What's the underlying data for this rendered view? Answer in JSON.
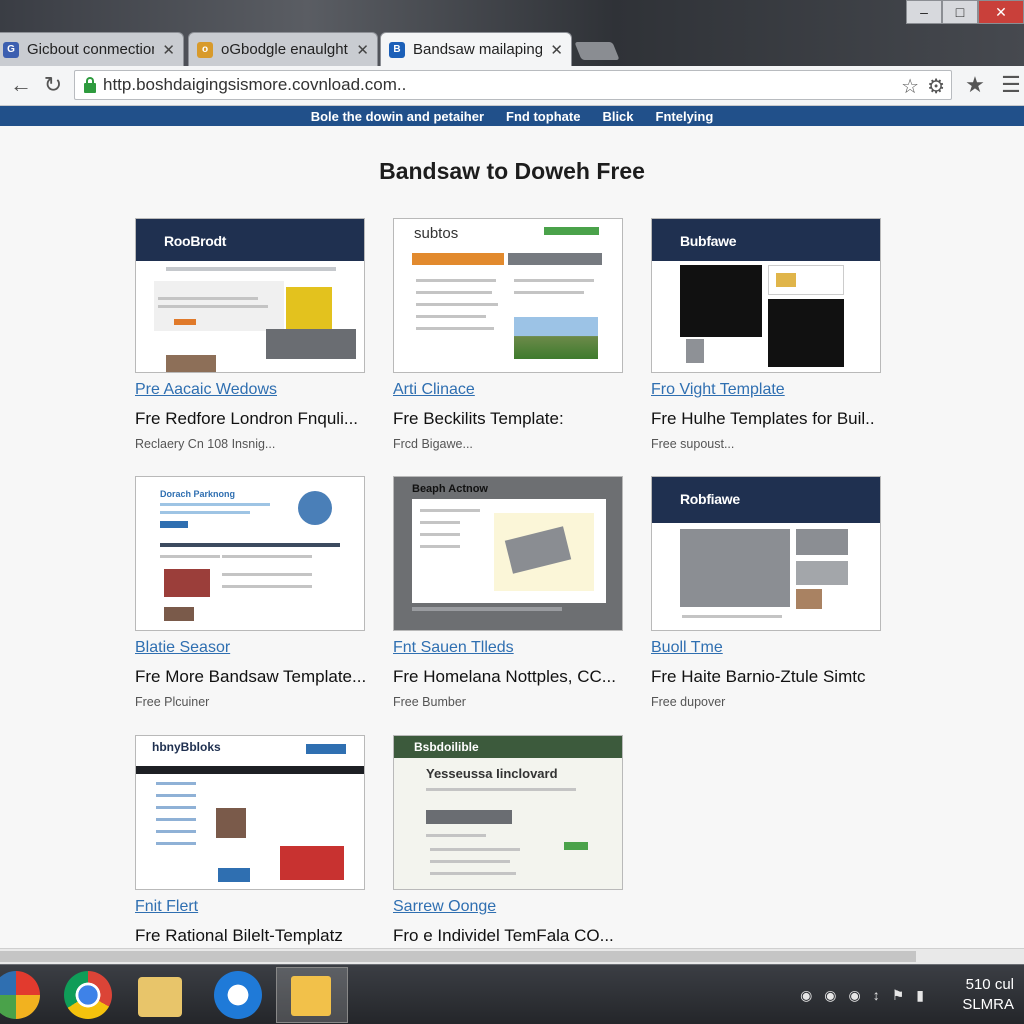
{
  "window": {
    "controls": [
      "–",
      "□",
      "✕"
    ]
  },
  "tabs": [
    {
      "label": "Gicbout conmections",
      "active": false,
      "favicon_color": "#3c5fb0",
      "favicon_glyph": "G"
    },
    {
      "label": "oGbodgle enaulghts",
      "active": false,
      "favicon_color": "#d89a2a",
      "favicon_glyph": "o"
    },
    {
      "label": "Bandsaw mailaping",
      "active": true,
      "favicon_color": "#1b5fb8",
      "favicon_glyph": "B"
    }
  ],
  "toolbar": {
    "url": "http.boshdaigingsismore.covnload.com..",
    "icons": [
      "back-arrow-icon",
      "forward-arrow-icon",
      "reload-icon",
      "star-icon",
      "settings-icon",
      "bookmark-icon",
      "menu-icon"
    ]
  },
  "site_nav": {
    "items": [
      "Bole the dowin and petaiher",
      "Fnd tophate",
      "Blick",
      "Fntelying"
    ]
  },
  "page": {
    "title": "Bandsaw to Doweh Free",
    "cards": [
      {
        "link": "Pre Aacaic Wedows",
        "name": "Fre Redfore Londron Fnquli...",
        "meta": "Reclaery Cn 108 Insnig...",
        "thumb_logo": "RooBrodt"
      },
      {
        "link": "Arti Clinace",
        "name": "Fre Beckilits Template:",
        "meta": "Frcd Bigawe...",
        "thumb_logo": "subtos"
      },
      {
        "link": "Fro Vight Template",
        "name": "Fre Hulhe Templates for Buil..",
        "meta": "Free supoust...",
        "thumb_logo": "Bubfawe"
      },
      {
        "link": "Blatie Seasor",
        "name": "Fre More Bandsaw Template...",
        "meta": "Free Plcuiner",
        "thumb_logo": "Dorach Parknong"
      },
      {
        "link": "Fnt Sauen Tlleds",
        "name": "Fre Homelana Nottples, CC...",
        "meta": "Free Bumber",
        "thumb_logo": "Beaph Actnow"
      },
      {
        "link": "Buoll Tme",
        "name": "Fre Haite Barnio-Ztule Simtc",
        "meta": "Free dupover",
        "thumb_logo": "Robfiawe"
      },
      {
        "link": "Fnit Flert",
        "name": "Fre Rational Bilelt-Templatz",
        "meta": "",
        "thumb_logo": "hbnyBbloks"
      },
      {
        "link": "Sarrew Oonge",
        "name": "Fro e Individel TemFala CO...",
        "meta": "",
        "thumb_logo": "Bsbdoilible",
        "thumb_heading": "Yesseussa Iinclovard"
      }
    ]
  },
  "taskbar": {
    "apps": [
      "beach-ball-app-icon",
      "chrome-icon",
      "folder-mail-icon",
      "ie-icon",
      "notepad-icon"
    ],
    "tray_icons": [
      "shield-icon",
      "network-icon",
      "volume-icon",
      "arrow-icon",
      "flag-icon",
      "battery-icon"
    ],
    "clock_time": "510 cul",
    "clock_date": "SLMRA"
  }
}
